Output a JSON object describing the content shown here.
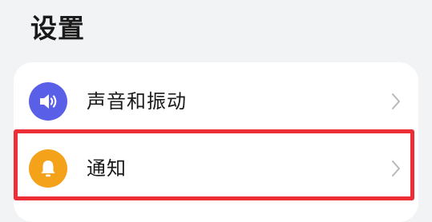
{
  "header": {
    "title": "设置"
  },
  "settings": {
    "items": [
      {
        "label": "声音和振动",
        "icon": "speaker-icon",
        "icon_color": "#5a5fe8"
      },
      {
        "label": "通知",
        "icon": "bell-icon",
        "icon_color": "#f5a21b"
      }
    ]
  },
  "colors": {
    "background": "#f1f3f5",
    "card": "#ffffff",
    "highlight": "#ee2e36",
    "chevron": "#b8b8b8"
  }
}
